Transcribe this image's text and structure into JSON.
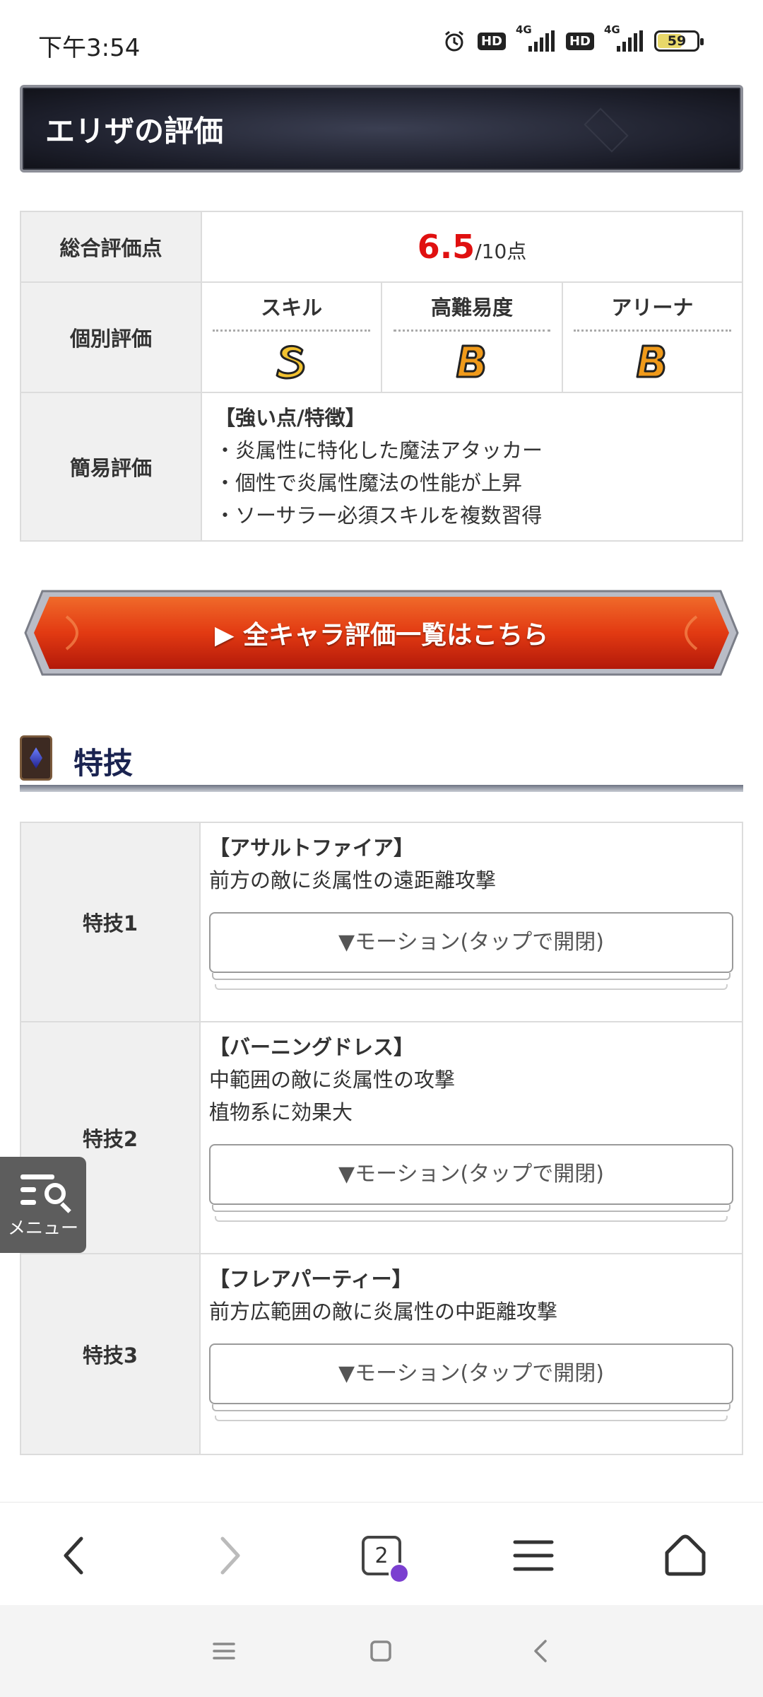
{
  "status_bar": {
    "time": "下午3:54",
    "hd1": "HD",
    "hd2": "HD",
    "net1": "4G",
    "net2": "4G",
    "battery": "59"
  },
  "banner": {
    "title": "エリザの評価"
  },
  "evaluation": {
    "overall_label": "総合評価点",
    "score": "6.5",
    "score_suffix": "/10点",
    "individual_label": "個別評価",
    "categories": [
      {
        "name": "スキル",
        "grade": "S"
      },
      {
        "name": "高難易度",
        "grade": "B"
      },
      {
        "name": "アリーナ",
        "grade": "B"
      }
    ],
    "simple_label": "簡易評価",
    "simple_heading": "【強い点/特徴】",
    "simple_points": [
      "・炎属性に特化した魔法アタッカー",
      "・個性で炎属性魔法の性能が上昇",
      "・ソーサラー必須スキルを複数習得"
    ]
  },
  "cta": {
    "label": "▶ 全キャラ評価一覧はこちら"
  },
  "section": {
    "title": "特技"
  },
  "skills": [
    {
      "label": "特技1",
      "name": "【アサルトファイア】",
      "lines": [
        "前方の敵に炎属性の遠距離攻撃"
      ],
      "motion": "▼モーション(タップで開閉)"
    },
    {
      "label": "特技2",
      "name": "【バーニングドレス】",
      "lines": [
        "中範囲の敵に炎属性の攻撃",
        "植物系に効果大"
      ],
      "motion": "▼モーション(タップで開閉)"
    },
    {
      "label": "特技3",
      "name": "【フレアパーティー】",
      "lines": [
        "前方広範囲の敵に炎属性の中距離攻撃"
      ],
      "motion": "▼モーション(タップで開閉)"
    }
  ],
  "float_menu": {
    "label": "メニュー"
  },
  "browser": {
    "tab_count": "2"
  },
  "colors": {
    "score_red": "#e01010",
    "grade_gold": "#f2c230",
    "grade_orange": "#f09a1a",
    "cta_red": "#d8280f"
  }
}
